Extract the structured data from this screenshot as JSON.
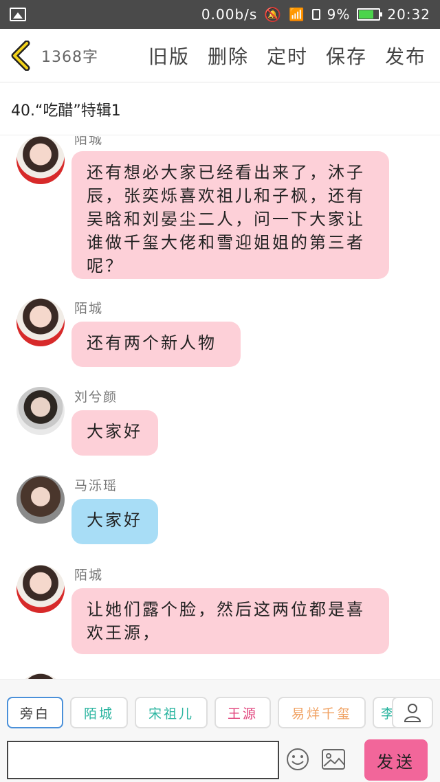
{
  "status_bar": {
    "speed": "0.00b/s",
    "battery_text": "9%",
    "time": "20:32"
  },
  "toolbar": {
    "word_count": "1368字",
    "actions": [
      "旧版",
      "删除",
      "定时",
      "保存",
      "发布"
    ]
  },
  "chapter_title": "40.“吃醋”特辑1",
  "messages": [
    {
      "name": "陌城",
      "text": "还有想必大家已经看出来了，沐子辰，张奕烁喜欢祖儿和子枫，还有吴晗和刘晏尘二人，问一下大家让谁做千玺大佬和雪迎姐姐的第三者呢？",
      "bubble_color": "#fdd0d8"
    },
    {
      "name": "陌城",
      "text": "还有两个新人物",
      "bubble_color": "#fdd0d8"
    },
    {
      "name": "刘兮颜",
      "text": "大家好",
      "bubble_color": "#fdd0d8"
    },
    {
      "name": "马泺瑶",
      "text": "大家好",
      "bubble_color": "#a8ddf6"
    },
    {
      "name": "陌城",
      "text": "让她们露个脸，然后这两位都是喜欢王源，",
      "bubble_color": "#fdd0d8"
    }
  ],
  "characters": [
    {
      "label": "旁白",
      "color": "#444444"
    },
    {
      "label": "陌城",
      "color": "#2bb5a0"
    },
    {
      "label": "宋祖儿",
      "color": "#2bb5a0"
    },
    {
      "label": "王源",
      "color": "#e0407a"
    },
    {
      "label": "易烊千玺",
      "color": "#f0a060"
    },
    {
      "label": "李",
      "color": "#2bb5a0"
    }
  ],
  "input": {
    "value": "",
    "placeholder": ""
  },
  "send_label": "发送"
}
